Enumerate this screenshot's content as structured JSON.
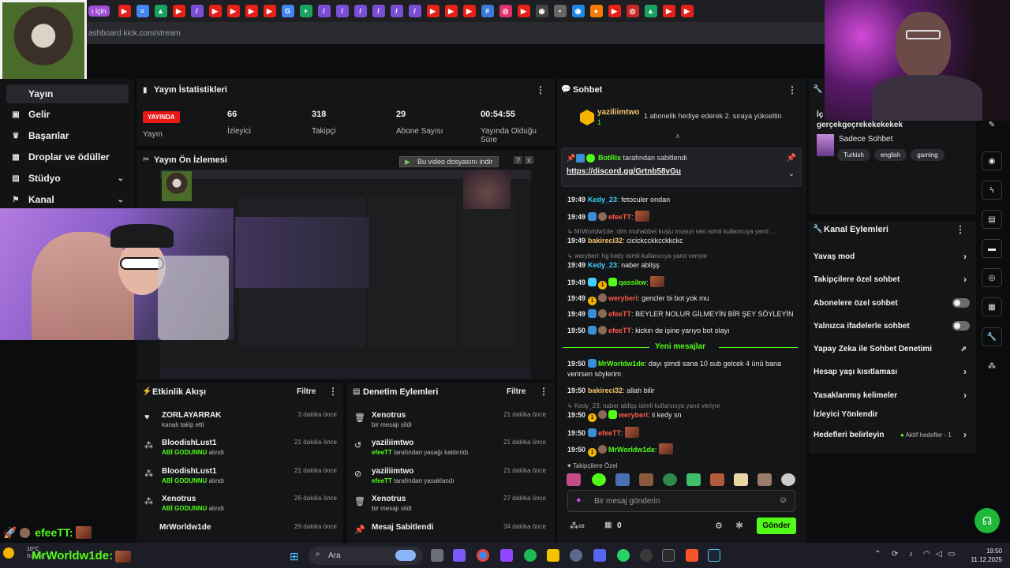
{
  "browser": {
    "active_tab": "ı için",
    "url": "ashboard.kick.com/stream"
  },
  "nav": {
    "items": [
      {
        "label": "Yayın",
        "icon": "broadcast-icon"
      },
      {
        "label": "Gelir",
        "icon": "revenue-icon"
      },
      {
        "label": "Başarılar",
        "icon": "trophy-icon"
      },
      {
        "label": "Droplar ve ödüller",
        "icon": "gift-icon"
      },
      {
        "label": "Stüdyo",
        "icon": "studio-icon"
      },
      {
        "label": "Kanal",
        "icon": "channel-icon"
      }
    ]
  },
  "stats": {
    "title": "Yayın İstatistikleri",
    "badge": "YAYINDA",
    "status_label": "Yayın",
    "items": [
      {
        "value": "66",
        "label": "İzleyici"
      },
      {
        "value": "318",
        "label": "Takipçi"
      },
      {
        "value": "29",
        "label": "Abone Sayısı"
      },
      {
        "value": "00:54:55",
        "label": "Yayında Olduğu Süre"
      }
    ]
  },
  "preview": {
    "title": "Yayın Ön İzlemesi",
    "download_label": "Bu video dosyasını indir",
    "help": "?",
    "close": "x"
  },
  "activity": {
    "title": "Etkinlik Akışı",
    "filter": "Filtre",
    "rows": [
      {
        "name": "ZORLAYARRAK",
        "sub": "kanalı takip etti",
        "highlight": "",
        "time": "3 dakika önce",
        "icon": "heart-icon"
      },
      {
        "name": "BloodishLust1",
        "sub": "alındı",
        "highlight": "ABİ GODUNNU",
        "time": "21 dakika önce",
        "icon": "reward-icon"
      },
      {
        "name": "BloodishLust1",
        "sub": "alındı",
        "highlight": "ABİ GODUNNU",
        "time": "21 dakika önce",
        "icon": "reward-icon"
      },
      {
        "name": "Xenotrus",
        "sub": "alındı",
        "highlight": "ABİ GODUNNU",
        "time": "26 dakika önce",
        "icon": "reward-icon"
      },
      {
        "name": "MrWorldw1de",
        "sub": "",
        "highlight": "",
        "time": "29 dakika önce",
        "icon": "reward-icon"
      }
    ]
  },
  "moderation": {
    "title": "Denetim Eylemleri",
    "filter": "Filtre",
    "rows": [
      {
        "name": "Xenotrus",
        "sub": "bir mesajı sildi",
        "highlight": "",
        "time": "21 dakika önce",
        "icon": "trash-icon"
      },
      {
        "name": "yaziliimtwo",
        "sub": "tarafından yasağı kaldırıldı",
        "highlight": "efeeTT",
        "time": "21 dakika önce",
        "icon": "unban-icon"
      },
      {
        "name": "yaziliimtwo",
        "sub": "tarafından yasaklandı",
        "highlight": "efeeTT",
        "time": "21 dakika önce",
        "icon": "ban-icon"
      },
      {
        "name": "Xenotrus",
        "sub": "bir mesajı sildi",
        "highlight": "",
        "time": "27 dakika önce",
        "icon": "trash-icon"
      },
      {
        "name": "Mesaj Sabitlendi",
        "sub": "",
        "highlight": "",
        "time": "34 dakika önce",
        "icon": "pin-icon"
      }
    ]
  },
  "chat": {
    "title": "Sohbet",
    "gifter": {
      "name": "yaziliimtwo",
      "count": "1",
      "message": "1 abonelik hediye ederek 2. sıraya yükseltin"
    },
    "pinned": {
      "by": "BotRix",
      "by_suffix": "tarafından sabitlendi",
      "link": "https://discord.gg/Grtnb58vGu"
    },
    "messages": [
      {
        "time": "19:49",
        "user": "Kedy_23",
        "color": "#3fd0ff",
        "text": "fetoculer ondan"
      },
      {
        "time": "19:49",
        "user": "efeeTT",
        "color": "#ff5a4a",
        "text": ""
      },
      {
        "reply": "MrWorldw1de: olm muhabbet kuşlu musun sen isimli kullanıcıya yanıt ..."
      },
      {
        "time": "19:49",
        "user": "bakireci32",
        "color": "#f5c36b",
        "text": "cicickcckkcckkckc"
      },
      {
        "reply": "weryberi: hg kedy isimli kullanıcıya yanıt veriyor"
      },
      {
        "time": "19:49",
        "user": "Kedy_23",
        "color": "#3fd0ff",
        "text": "naber ablişş"
      },
      {
        "time": "19:49",
        "user": "qassikw",
        "color": "#53fc18",
        "text": ""
      },
      {
        "time": "19:49",
        "user": "weryberi",
        "color": "#ff5a4a",
        "text": "gencler bi bot yok mu"
      },
      {
        "time": "19:49",
        "user": "efeeTT",
        "color": "#ff5a4a",
        "text": "BEYLER NOLUR GİLMEYİN BİR ŞEY SÖYLEYİN"
      },
      {
        "time": "19:50",
        "user": "efeeTT",
        "color": "#ff5a4a",
        "text": "kickin de işine yarıyo bot olayı"
      }
    ],
    "new_messages_label": "Yeni mesajlar",
    "new_messages": [
      {
        "time": "19:50",
        "user": "MrWorldw1de",
        "color": "#53fc18",
        "text": "dayı şimdi sana 10 sub gelcek 4 ünü bana verirsen söylerim"
      },
      {
        "time": "19:50",
        "user": "bakireci32",
        "color": "#f5c36b",
        "text": "allah bilir"
      },
      {
        "reply": "Kedy_23: naber ablişş isimli kullanıcıya yanıt veriyor"
      },
      {
        "time": "19:50",
        "user": "weryberi",
        "color": "#ff5a4a",
        "text": "ii kedy sn"
      },
      {
        "time": "19:50",
        "user": "efeeTT",
        "color": "#ff5a4a",
        "text": ""
      },
      {
        "time": "19:50",
        "user": "MrWorldw1de",
        "color": "#53fc18",
        "text": ""
      }
    ],
    "emote_section": "Takipçilere Özel",
    "input_placeholder": "Bir mesaj gönderin",
    "points": "0",
    "send_label": "Gönder"
  },
  "channel": {
    "title_partial": "İç",
    "stream_title": "gerçekgeçrekekekekek",
    "mode": "Sadece Sohbet",
    "tags": [
      "Turkish",
      "english",
      "gaming"
    ]
  },
  "actions": {
    "title": "Kanal Eylemleri",
    "rows": [
      {
        "label": "Yavaş mod",
        "control": "chevron"
      },
      {
        "label": "Takipçilere özel sohbet",
        "control": "chevron"
      },
      {
        "label": "Abonelere özel sohbet",
        "control": "toggle"
      },
      {
        "label": "Yalnızca ifadelerle sohbet",
        "control": "toggle"
      },
      {
        "label": "Yapay Zeka ile Sohbet Denetimi",
        "control": "external"
      },
      {
        "label": "Hesap yaşı kısıtlaması",
        "control": "chevron"
      },
      {
        "label": "Yasaklanmış kelimeler",
        "control": "chevron"
      },
      {
        "label": "İzleyici Yönlendir",
        "control": "none"
      },
      {
        "label": "Hedefleri belirleyin",
        "control": "chevron",
        "extra": "Aktif hedefler - 1"
      }
    ]
  },
  "overlay": {
    "alert_user1": "efeeTT:",
    "alert_user2": "MrWorldw1de:",
    "weather": "10°C",
    "weather_sub": "Bulutlu"
  },
  "taskbar": {
    "search_placeholder": "Ara",
    "time": "19:50",
    "date": "11.12.2025"
  },
  "colors": {
    "kick_green": "#53fc18",
    "live_red": "#e91916",
    "panel": "#141516"
  }
}
